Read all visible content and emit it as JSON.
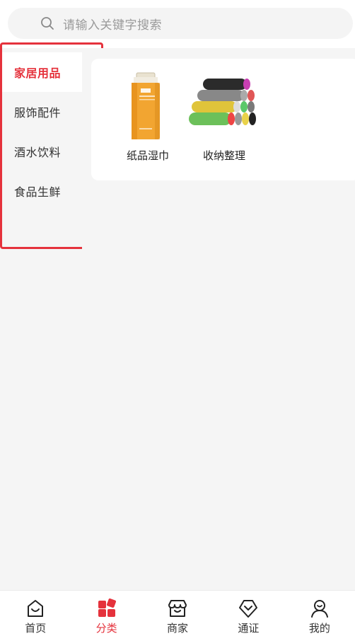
{
  "search": {
    "placeholder": "请输入关键字搜索"
  },
  "sidebar": {
    "items": [
      {
        "label": "家居用品",
        "active": true
      },
      {
        "label": "服饰配件",
        "active": false
      },
      {
        "label": "酒水饮料",
        "active": false
      },
      {
        "label": "食品生鲜",
        "active": false
      }
    ]
  },
  "products": [
    {
      "label": "纸品湿巾",
      "icon": "tissue-pack-icon"
    },
    {
      "label": "收纳整理",
      "icon": "trash-bag-rolls-icon"
    }
  ],
  "tabbar": {
    "items": [
      {
        "label": "首页",
        "icon": "home-icon",
        "active": false
      },
      {
        "label": "分类",
        "icon": "category-icon",
        "active": true
      },
      {
        "label": "商家",
        "icon": "store-icon",
        "active": false
      },
      {
        "label": "通证",
        "icon": "token-icon",
        "active": false
      },
      {
        "label": "我的",
        "icon": "profile-icon",
        "active": false
      }
    ]
  },
  "colors": {
    "accent": "#e5323c",
    "background": "#f5f5f5"
  }
}
